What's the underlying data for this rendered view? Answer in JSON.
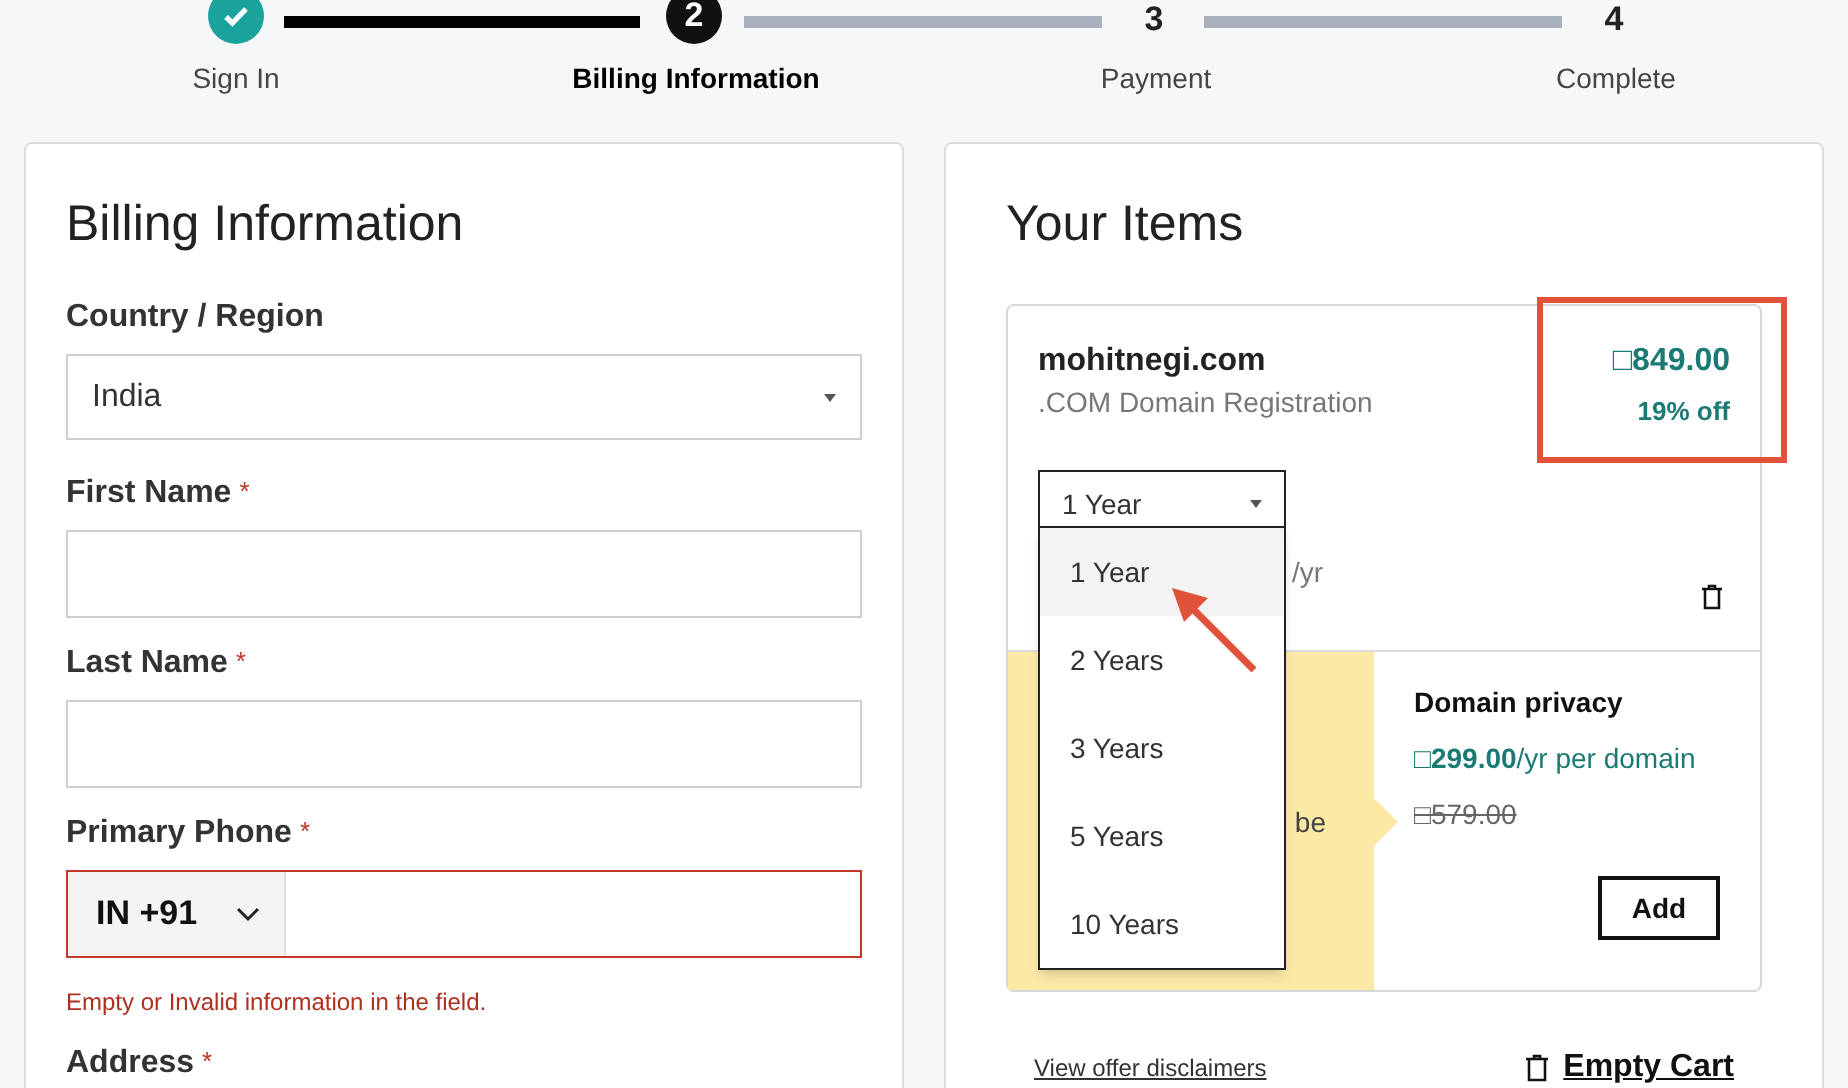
{
  "steps": [
    {
      "label": "Sign In",
      "completed": true,
      "selected": false
    },
    {
      "label": "Billing Information",
      "number": "2",
      "completed": false,
      "selected": true
    },
    {
      "label": "Payment",
      "number": "3",
      "completed": false,
      "selected": false
    },
    {
      "label": "Complete",
      "number": "4",
      "completed": false,
      "selected": false
    }
  ],
  "billing": {
    "title": "Billing Information",
    "fields": [
      {
        "kind": "select",
        "label": "Country / Region",
        "value": "India"
      },
      {
        "kind": "text",
        "label": "First Name",
        "required_mark": "*"
      },
      {
        "kind": "text",
        "label": "Last Name",
        "required_mark": "*"
      },
      {
        "kind": "phone",
        "label": "Primary Phone",
        "required_mark": "*",
        "country_code": "IN +91",
        "invalid": true,
        "error": "Empty or Invalid information in the field."
      },
      {
        "kind": "label",
        "label": "Address",
        "required_mark": "*"
      }
    ]
  },
  "items": {
    "title": "Your Items",
    "item": {
      "name": "mohitnegi.com",
      "subtitle": ".COM Domain Registration",
      "price": "□849.00",
      "discount": "19% off",
      "term_fragment": "/yr",
      "term_select": {
        "value": "1 Year",
        "open": true,
        "options": [
          {
            "label": "1 Year",
            "selected": true
          },
          {
            "label": "2 Years",
            "selected": false
          },
          {
            "label": "3 Years",
            "selected": false
          },
          {
            "label": "5 Years",
            "selected": false
          },
          {
            "label": "10 Years",
            "selected": false
          }
        ]
      }
    },
    "offer": {
      "text_fragment": "be",
      "title": "Domain privacy",
      "price": "□**299.00**/yr per domain",
      "old_price": "□579.00",
      "button": "Add"
    },
    "disclaimer_link": "View offer disclaimers",
    "empty_cart": "Empty Cart"
  }
}
